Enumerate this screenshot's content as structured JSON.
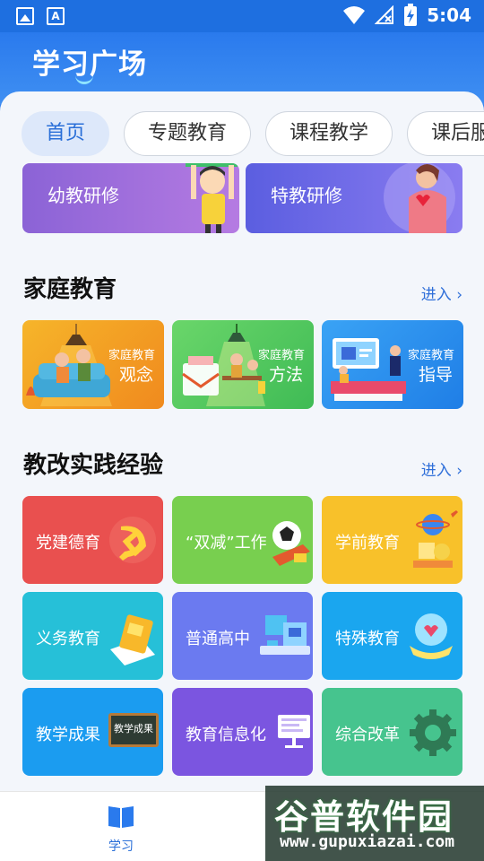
{
  "status_bar": {
    "time": "5:04"
  },
  "header": {
    "title": "学习广场"
  },
  "tabs": [
    {
      "label": "首页",
      "active": true
    },
    {
      "label": "专题教育"
    },
    {
      "label": "课程教学"
    },
    {
      "label": "课后服"
    }
  ],
  "banners": [
    {
      "label": "幼教研修"
    },
    {
      "label": "特教研修"
    }
  ],
  "family_section": {
    "title": "家庭教育",
    "enter": "进入 ›",
    "cards": [
      {
        "small": "家庭教育",
        "big": "观念"
      },
      {
        "small": "家庭教育",
        "big": "方法"
      },
      {
        "small": "家庭教育",
        "big": "指导"
      }
    ]
  },
  "practice_section": {
    "title": "教改实践经验",
    "enter": "进入 ›",
    "cards": [
      {
        "label": "党建德育",
        "color": "#e9504f"
      },
      {
        "label": "“双减”工作",
        "color": "#78cf4f"
      },
      {
        "label": "学前教育",
        "color": "#f8c12a"
      },
      {
        "label": "义务教育",
        "color": "#26c0d8"
      },
      {
        "label": "普通高中",
        "color": "#6b7af0"
      },
      {
        "label": "特殊教育",
        "color": "#1aa6ef"
      },
      {
        "label": "教学成果",
        "color": "#1b9cf0"
      },
      {
        "label": "教育信息化",
        "color": "#7b55e0"
      },
      {
        "label": "综合改革",
        "color": "#46c48e"
      }
    ],
    "blackboard_text": "教学成果"
  },
  "bottom_nav": {
    "items": [
      {
        "label": "学习",
        "active": true
      }
    ]
  },
  "watermark": {
    "big": "谷普软件园",
    "small": "www.gupuxiazai.com"
  }
}
